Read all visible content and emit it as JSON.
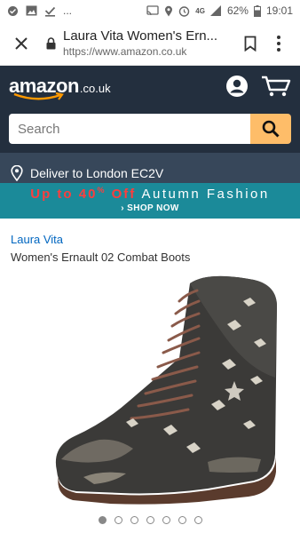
{
  "status_bar": {
    "battery": "62%",
    "time": "19:01",
    "ellipsis": "...",
    "network": "4G"
  },
  "browser": {
    "page_title": "Laura Vita Women's Ern...",
    "url": "https://www.amazon.co.uk"
  },
  "header": {
    "logo_word": "amazon",
    "logo_tld": ".co.uk",
    "search_placeholder": "Search",
    "deliver_text": "Deliver to London EC2V"
  },
  "promo": {
    "prefix": "Up to",
    "percent": "40",
    "percent_sign": "%",
    "off": "Off",
    "campaign": "Autumn Fashion",
    "cta": "› SHOP NOW"
  },
  "product": {
    "brand": "Laura Vita",
    "title": "Women's Ernault 02 Combat Boots",
    "image_count": 7,
    "active_image": 1
  },
  "colors": {
    "header_bg": "#232f3e",
    "deliver_bg": "#37475a",
    "search_button": "#febd69",
    "promo_bg": "#1b8a99",
    "promo_accent": "#ff3d3d",
    "link": "#0066c0"
  }
}
